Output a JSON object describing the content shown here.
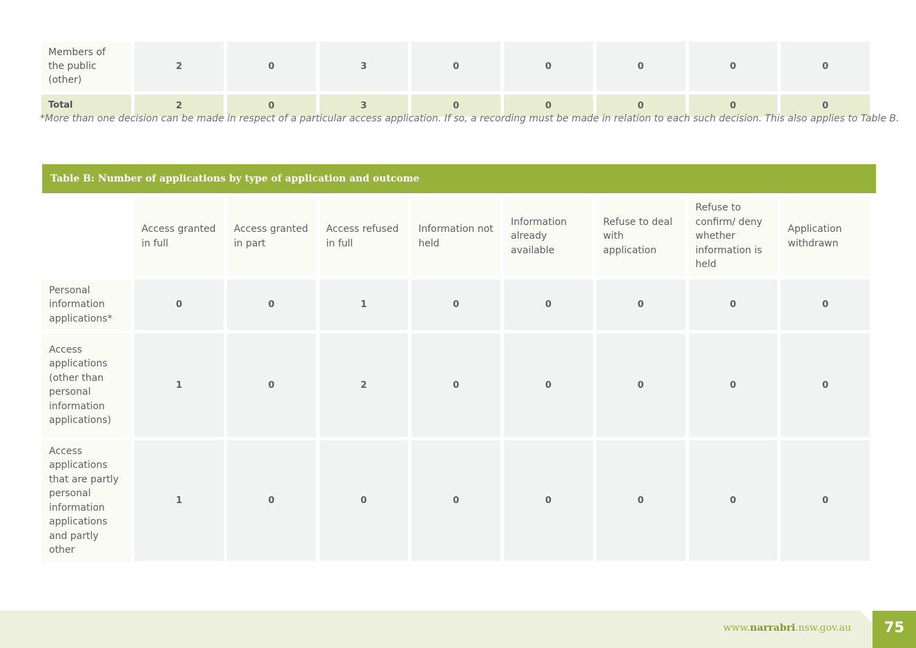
{
  "table_a": {
    "rows": [
      {
        "label": "Members of the public (other)",
        "values": [
          "2",
          "0",
          "3",
          "0",
          "0",
          "0",
          "0",
          "0"
        ]
      },
      {
        "label": "Total",
        "values": [
          "2",
          "0",
          "3",
          "0",
          "0",
          "0",
          "0",
          "0"
        ]
      }
    ]
  },
  "footnote": "*More than one decision can be made in respect of a particular access application. If so, a recording must be made in relation to each such decision. This also applies to Table B.",
  "table_b": {
    "title": "Table B: Number of applications by type of application and outcome",
    "columns": [
      "Access granted in full",
      "Access granted in part",
      "Access refused in full",
      "Information not held",
      "Information already available",
      "Refuse to deal with application",
      "Refuse to confirm/ deny whether information is held",
      "Application withdrawn"
    ],
    "rows": [
      {
        "label": "Personal information applications*",
        "values": [
          "0",
          "0",
          "1",
          "0",
          "0",
          "0",
          "0",
          "0"
        ]
      },
      {
        "label": "Access applications (other than personal information applications)",
        "values": [
          "1",
          "0",
          "2",
          "0",
          "0",
          "0",
          "0",
          "0"
        ]
      },
      {
        "label": "Access applications that are partly personal information applications and partly other",
        "values": [
          "1",
          "0",
          "0",
          "0",
          "0",
          "0",
          "0",
          "0"
        ]
      }
    ]
  },
  "footer": {
    "url_prefix": "www.",
    "url_bold": "narrabri",
    "url_suffix": ".nsw.gov.au",
    "page_number": "75"
  },
  "colors": {
    "accent_green": "#97b23a",
    "total_row": "#e8edd2",
    "cell_grey": "#f1f2f2"
  }
}
